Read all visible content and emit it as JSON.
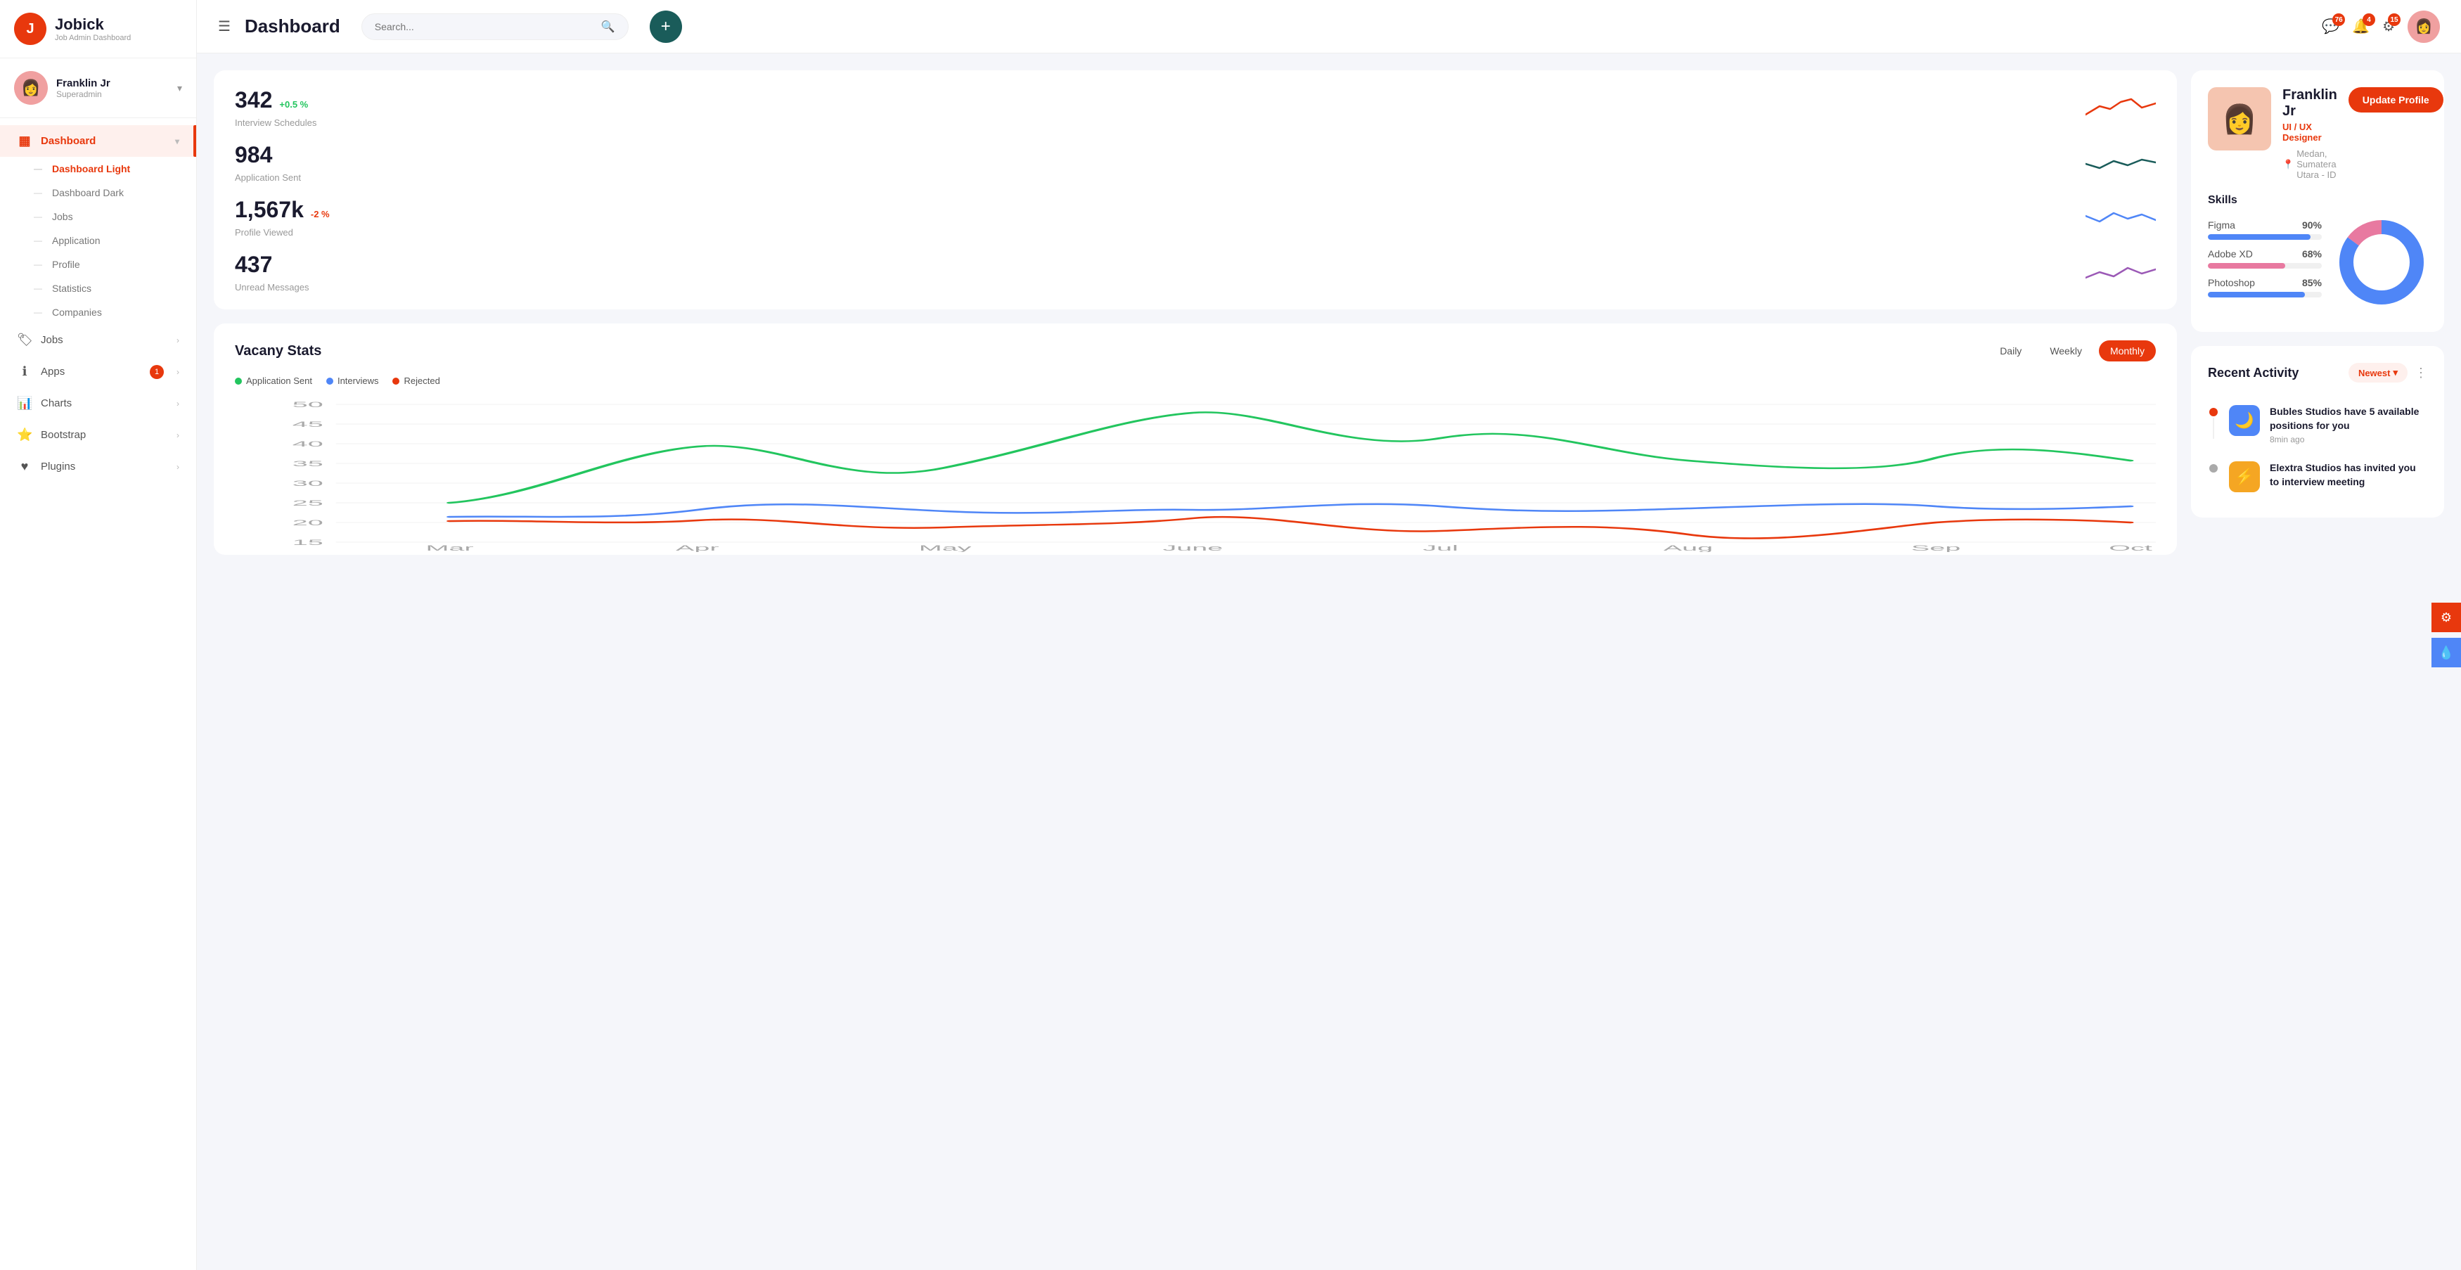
{
  "logo": {
    "icon": "J",
    "title": "Jobick",
    "subtitle": "Job Admin Dashboard"
  },
  "user": {
    "name": "Franklin Jr",
    "role": "Superadmin",
    "avatar": "👩"
  },
  "nav": {
    "main_items": [
      {
        "id": "dashboard",
        "label": "Dashboard",
        "icon": "▦",
        "active": true,
        "has_chevron": true
      },
      {
        "id": "jobs",
        "label": "Jobs",
        "icon": "🏷",
        "active": false,
        "has_chevron": true
      },
      {
        "id": "apps",
        "label": "Apps",
        "icon": "ℹ",
        "active": false,
        "has_chevron": true,
        "badge": "1"
      },
      {
        "id": "charts",
        "label": "Charts",
        "icon": "📊",
        "active": false,
        "has_chevron": true
      },
      {
        "id": "bootstrap",
        "label": "Bootstrap",
        "icon": "⭐",
        "active": false,
        "has_chevron": true
      },
      {
        "id": "plugins",
        "label": "Plugins",
        "icon": "♥",
        "active": false,
        "has_chevron": true
      }
    ],
    "sub_items": [
      {
        "id": "dashboard-light",
        "label": "Dashboard Light",
        "active": true
      },
      {
        "id": "dashboard-dark",
        "label": "Dashboard Dark",
        "active": false
      },
      {
        "id": "jobs",
        "label": "Jobs",
        "active": false
      },
      {
        "id": "application",
        "label": "Application",
        "active": false
      },
      {
        "id": "profile",
        "label": "Profile",
        "active": false
      },
      {
        "id": "statistics",
        "label": "Statistics",
        "active": false
      },
      {
        "id": "companies",
        "label": "Companies",
        "active": false
      }
    ]
  },
  "header": {
    "title": "Dashboard",
    "search_placeholder": "Search...",
    "add_btn_label": "+",
    "badges": {
      "messages": "76",
      "notifications": "4",
      "settings": "15"
    }
  },
  "stats": [
    {
      "id": "interview",
      "value": "342",
      "change": "+0.5 %",
      "change_type": "positive",
      "label": "Interview Schedules",
      "color": "#e8380d"
    },
    {
      "id": "application",
      "value": "984",
      "change": "",
      "label": "Application Sent",
      "color": "#1a5c5a"
    },
    {
      "id": "profile",
      "value": "1,567k",
      "change": "-2 %",
      "change_type": "negative",
      "label": "Profile Viewed",
      "color": "#4f86f7"
    },
    {
      "id": "messages",
      "value": "437",
      "change": "",
      "label": "Unread Messages",
      "color": "#9b59b6"
    }
  ],
  "vacancy": {
    "title": "Vacany Stats",
    "filters": [
      {
        "label": "Daily",
        "active": false
      },
      {
        "label": "Weekly",
        "active": false
      },
      {
        "label": "Monthly",
        "active": true
      }
    ],
    "legend": [
      {
        "label": "Application Sent",
        "color": "#22c55e"
      },
      {
        "label": "Interviews",
        "color": "#4f86f7"
      },
      {
        "label": "Rejected",
        "color": "#e8380d"
      }
    ],
    "x_labels": [
      "Mar",
      "Apr",
      "May",
      "June",
      "Jul",
      "Aug",
      "Sep",
      "Oct"
    ],
    "y_labels": [
      "50",
      "45",
      "40",
      "35",
      "30",
      "25",
      "20",
      "15"
    ]
  },
  "profile_card": {
    "name": "Franklin Jr",
    "role": "UI / UX Designer",
    "location": "Medan, Sumatera Utara - ID",
    "update_btn": "Update Profile",
    "skills_title": "Skills",
    "skills": [
      {
        "name": "Figma",
        "pct": 90,
        "pct_label": "90%",
        "color": "#4f86f7"
      },
      {
        "name": "Adobe XD",
        "pct": 68,
        "pct_label": "68%",
        "color": "#e879a0"
      },
      {
        "name": "Photoshop",
        "pct": 85,
        "pct_label": "85%",
        "color": "#4f86f7"
      }
    ]
  },
  "activity": {
    "title": "Recent Activity",
    "filter_label": "Newest",
    "items": [
      {
        "id": "bubles",
        "dot_color": "#e8380d",
        "icon_bg": "#4f86f7",
        "icon": "🌙",
        "text": "Bubles Studios have 5 available positions for you",
        "time": "8min ago"
      },
      {
        "id": "elextra",
        "dot_color": "#999",
        "icon_bg": "#f5a623",
        "icon": "⚡",
        "text": "Elextra Studios has invited you to interview meeting",
        "time": ""
      }
    ]
  },
  "panel_btns": [
    {
      "id": "settings",
      "icon": "⚙",
      "color": "orange"
    },
    {
      "id": "paint",
      "icon": "🎨",
      "color": "blue"
    }
  ]
}
